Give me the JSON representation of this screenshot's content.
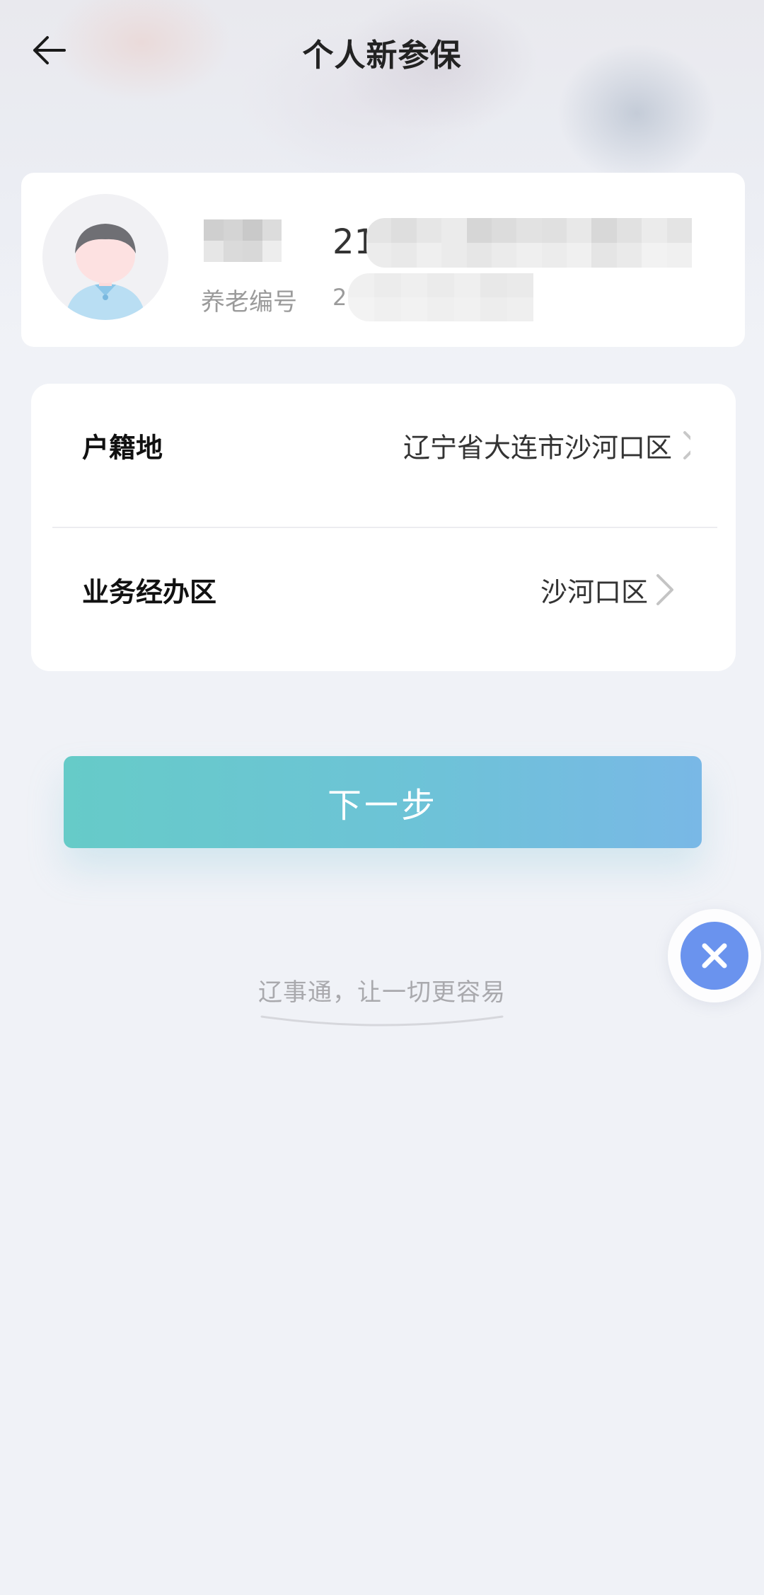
{
  "header": {
    "title": "个人新参保",
    "back_icon": "arrow-left-icon"
  },
  "user": {
    "id_prefix": "21",
    "pension_label": "养老编号",
    "pension_prefix": "2"
  },
  "form": {
    "household": {
      "label": "户籍地",
      "value": "辽宁省大连市沙河口区"
    },
    "business_area": {
      "label": "业务经办区",
      "value": "沙河口区"
    }
  },
  "actions": {
    "next_label": "下一步",
    "float_close_icon": "close-icon"
  },
  "footer": {
    "slogan": "辽事通，让一切更容易"
  },
  "colors": {
    "button_gradient_start": "#66cbc8",
    "button_gradient_end": "#79b8e6",
    "float_button": "#6a93ee"
  }
}
